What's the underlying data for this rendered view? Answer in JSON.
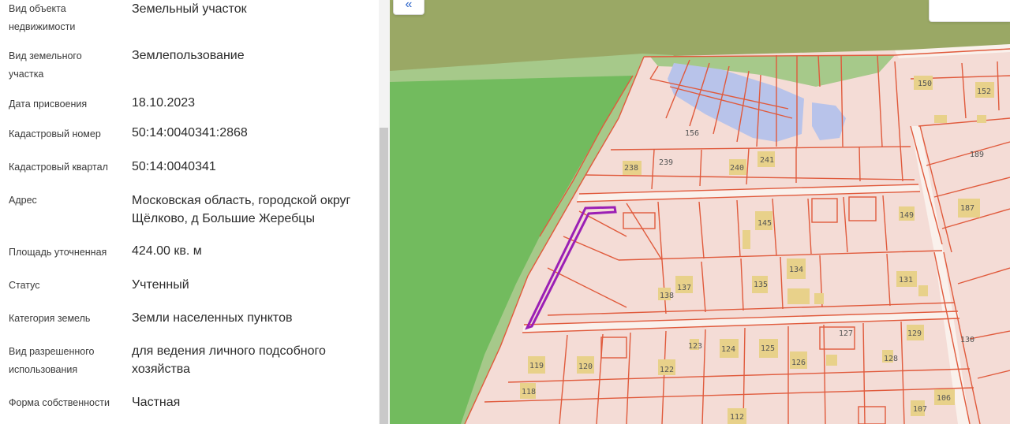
{
  "properties": [
    {
      "label": "Вид объекта недвижимости",
      "value": "Земельный участок"
    },
    {
      "label": "Вид земельного участка",
      "value": "Землепользование"
    },
    {
      "label": "Дата присвоения",
      "value": "18.10.2023"
    },
    {
      "label": "Кадастровый номер",
      "value": "50:14:0040341:2868"
    },
    {
      "label": "Кадастровый квартал",
      "value": "50:14:0040341"
    },
    {
      "label": "Адрес",
      "value": "Московская область, городской округ Щёлково, д Большие Жеребцы"
    },
    {
      "label": "Площадь уточненная",
      "value": "424.00 кв. м"
    },
    {
      "label": "Статус",
      "value": "Учтенный"
    },
    {
      "label": "Категория земель",
      "value": "Земли населенных пунктов"
    },
    {
      "label": "Вид разрешенного использования",
      "value": "для ведения личного подсобного хозяйства"
    },
    {
      "label": "Форма собственности",
      "value": "Частная"
    }
  ],
  "map": {
    "collapse_icon": "«",
    "colors": {
      "forest": "#72bb5e",
      "meadow": "#9aa865",
      "grass": "#a6c98a",
      "parcel_fill": "#f4dcd6",
      "parcel_border": "#e05a3c",
      "road": "#faf1ec",
      "water": "#b8c3ea",
      "building": "#e8d18a",
      "selected": "#9b1fb5"
    },
    "plot_labels": [
      "150",
      "152",
      "156",
      "189",
      "238",
      "239",
      "240",
      "241",
      "187",
      "149",
      "145",
      "134",
      "137",
      "135",
      "131",
      "138",
      "127",
      "129",
      "130",
      "123",
      "124",
      "125",
      "126",
      "128",
      "119",
      "120",
      "122",
      "118",
      "112",
      "107",
      "106"
    ]
  }
}
